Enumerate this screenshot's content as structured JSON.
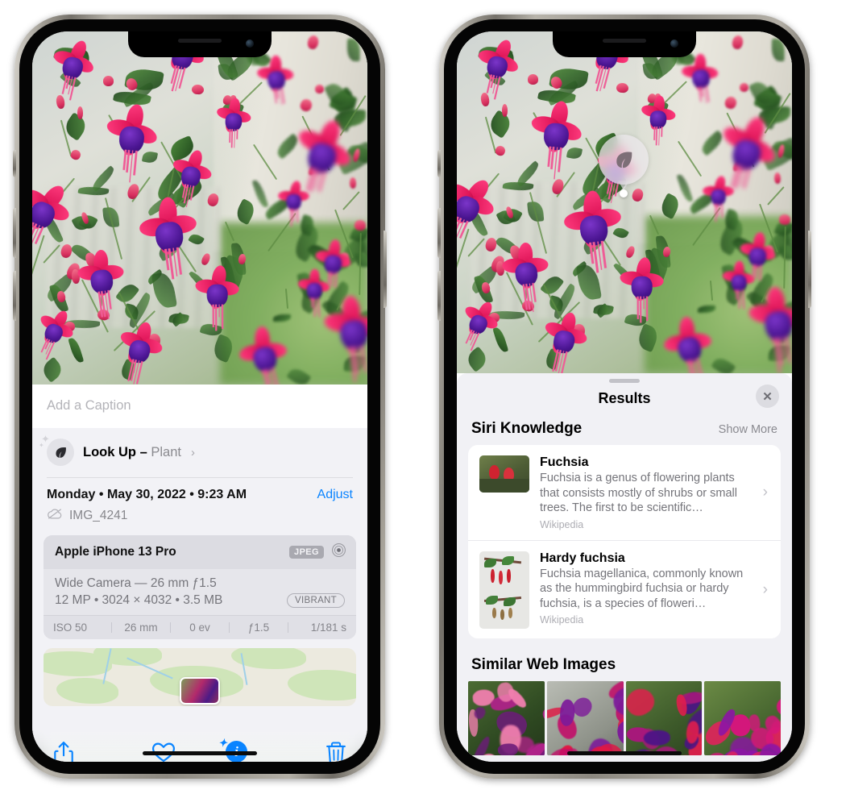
{
  "left_phone": {
    "photo": {
      "alt": "fuchsia-flowers-photo"
    },
    "caption_placeholder": "Add a Caption",
    "lookup": {
      "icon": "leaf-icon",
      "sparkle": "✦",
      "label": "Look Up",
      "separator": " – ",
      "subject": "Plant",
      "chevron": "›"
    },
    "date": {
      "text": "Monday • May 30, 2022 • 9:23 AM",
      "adjust_label": "Adjust",
      "cloud_icon": "cloud-slash-icon",
      "filename": "IMG_4241"
    },
    "exif": {
      "device": "Apple iPhone 13 Pro",
      "format_badge": "JPEG",
      "aperture_icon": "aperture-icon",
      "lens_line": "Wide Camera — 26 mm ƒ1.5",
      "size_line": "12 MP • 3024 × 4032 • 3.5 MB",
      "style_badge": "VIBRANT",
      "stats": [
        "ISO 50",
        "26 mm",
        "0 ev",
        "ƒ1.5",
        "1/181 s"
      ]
    },
    "map": {
      "name": "location-map-thumbnail"
    },
    "toolbar": [
      {
        "name": "share-button",
        "icon": "share-icon"
      },
      {
        "name": "favorite-button",
        "icon": "heart-icon"
      },
      {
        "name": "info-button",
        "icon": "info-sparkle-icon",
        "glyph": "i",
        "active": true
      },
      {
        "name": "delete-button",
        "icon": "trash-icon"
      }
    ]
  },
  "right_phone": {
    "visual_lookup_badge": {
      "icon": "leaf-icon"
    },
    "sheet": {
      "title": "Results",
      "close_label": "✕",
      "siri_section": {
        "title": "Siri Knowledge",
        "show_more": "Show More",
        "entries": [
          {
            "name": "Fuchsia",
            "description": "Fuchsia is a genus of flowering plants that consists mostly of shrubs or small trees. The first to be scientific…",
            "source": "Wikipedia",
            "chevron": "›"
          },
          {
            "name": "Hardy fuchsia",
            "description": "Fuchsia magellanica, commonly known as the hummingbird fuchsia or hardy fuchsia, is a species of floweri…",
            "source": "Wikipedia",
            "chevron": "›"
          }
        ]
      },
      "similar_section": {
        "title": "Similar Web Images",
        "thumbnails": [
          "fuchsia-web-image-1",
          "fuchsia-web-image-2",
          "fuchsia-web-image-3",
          "fuchsia-web-image-4"
        ]
      }
    }
  },
  "colors": {
    "accent_blue": "#0a84ff",
    "sheet_bg": "#f1f1f5",
    "card_bg": "#ffffff",
    "secondary_text": "#8a8a90"
  }
}
